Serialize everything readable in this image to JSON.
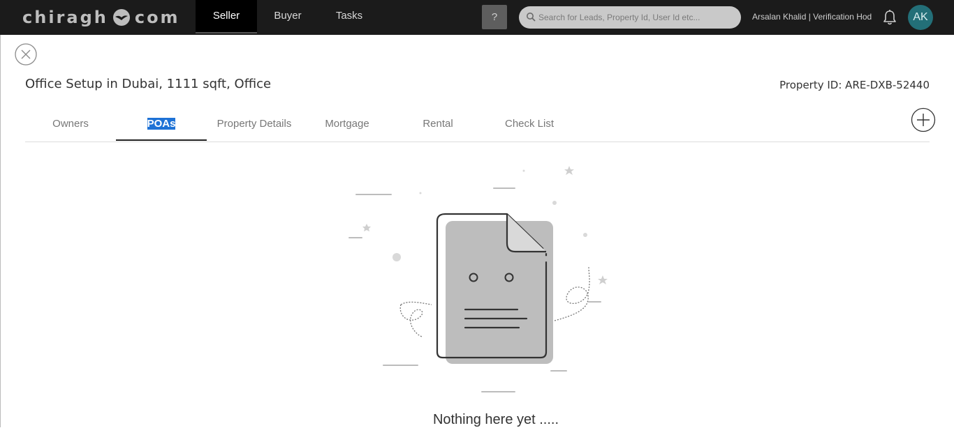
{
  "header": {
    "logo_text_left": "chiragh",
    "logo_text_right": "com",
    "nav": [
      {
        "label": "Seller",
        "active": true
      },
      {
        "label": "Buyer",
        "active": false
      },
      {
        "label": "Tasks",
        "active": false
      }
    ],
    "help_label": "?",
    "search_placeholder": "Search for Leads, Property Id, User Id etc...",
    "user_name": "Arsalan Khalid | Verification Hod",
    "avatar_initials": "AK"
  },
  "property": {
    "title": "Office Setup in Dubai, 1111 sqft, Office",
    "id_label": "Property ID: ARE-DXB-52440"
  },
  "tabs": [
    {
      "label": "Owners",
      "active": false
    },
    {
      "label": "POAs",
      "active": true
    },
    {
      "label": "Property Details",
      "active": false
    },
    {
      "label": "Mortgage",
      "active": false
    },
    {
      "label": "Rental",
      "active": false
    },
    {
      "label": "Check List",
      "active": false
    }
  ],
  "empty_state": {
    "message": "Nothing here yet ....."
  },
  "colors": {
    "topbar": "#1b1b1b",
    "avatar": "#236f78",
    "selection": "#1e72d6"
  }
}
